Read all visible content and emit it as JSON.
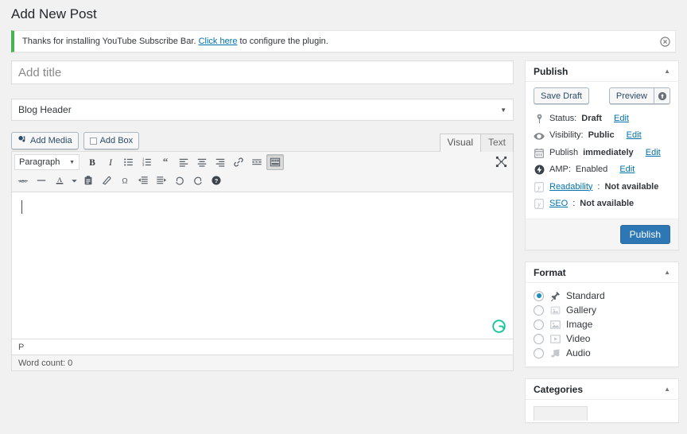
{
  "page": {
    "title": "Add New Post"
  },
  "notice": {
    "text_before": "Thanks for installing YouTube Subscribe Bar. ",
    "link": "Click here",
    "text_after": " to configure the plugin.",
    "dismiss_icon": "dismiss-circle-icon",
    "accent_color": "#46b450"
  },
  "title_field": {
    "value": "",
    "placeholder": "Add title"
  },
  "template": {
    "selected": "Blog Header",
    "caret": "▼"
  },
  "editor": {
    "add_media_label": "Add Media",
    "add_box_label": "Add Box",
    "tabs": [
      {
        "label": "Visual",
        "active": true
      },
      {
        "label": "Text",
        "active": false
      }
    ],
    "style_select": {
      "value": "Paragraph",
      "caret": "▼"
    },
    "toolbar_row1": [
      {
        "name": "bold-icon",
        "glyph": "B"
      },
      {
        "name": "italic-icon",
        "glyph": "I"
      },
      {
        "name": "bulleted-list-icon",
        "glyph": ""
      },
      {
        "name": "numbered-list-icon",
        "glyph": ""
      },
      {
        "name": "blockquote-icon",
        "glyph": "“"
      },
      {
        "name": "align-left-icon",
        "glyph": ""
      },
      {
        "name": "align-center-icon",
        "glyph": ""
      },
      {
        "name": "align-right-icon",
        "glyph": ""
      },
      {
        "name": "insert-link-icon",
        "glyph": ""
      },
      {
        "name": "read-more-icon",
        "glyph": ""
      },
      {
        "name": "toolbar-toggle-icon",
        "glyph": "",
        "pressed": true
      }
    ],
    "toolbar_row2": [
      {
        "name": "strikethrough-icon",
        "glyph": "ABC"
      },
      {
        "name": "horizontal-rule-icon",
        "glyph": "—"
      },
      {
        "name": "text-color-icon",
        "glyph": "A"
      },
      {
        "name": "text-color-caret-icon",
        "glyph": "▼"
      },
      {
        "name": "paste-as-text-icon",
        "glyph": ""
      },
      {
        "name": "clear-formatting-icon",
        "glyph": ""
      },
      {
        "name": "special-character-icon",
        "glyph": "Ω"
      },
      {
        "name": "outdent-icon",
        "glyph": ""
      },
      {
        "name": "indent-icon",
        "glyph": ""
      },
      {
        "name": "undo-icon",
        "glyph": ""
      },
      {
        "name": "redo-icon",
        "glyph": ""
      },
      {
        "name": "keyboard-shortcuts-icon",
        "glyph": "?"
      }
    ],
    "fullscreen_icon": "distraction-free-mode-icon",
    "content": "",
    "grammarly_icon": "grammarly-badge-icon",
    "path": "P",
    "word_count": "Word count: 0"
  },
  "publish_box": {
    "title": "Publish",
    "toggle": "▲",
    "save_draft_label": "Save Draft",
    "preview_label": "Preview",
    "preview_extra_icon": "preview-options-icon",
    "rows": [
      {
        "icon": "pin-icon",
        "label": "Status: ",
        "value": "Draft",
        "edit": "Edit",
        "value_bold": true
      },
      {
        "icon": "eye-icon",
        "label": "Visibility: ",
        "value": "Public",
        "edit": "Edit",
        "value_bold": true
      },
      {
        "icon": "calendar-icon",
        "label": "Publish ",
        "value": "immediately",
        "edit": "Edit",
        "value_bold": true
      },
      {
        "icon": "amp-icon",
        "label": "AMP: ",
        "value": "Enabled",
        "edit": "Edit",
        "value_bold": false
      },
      {
        "icon": "yoast-icon",
        "label_link": "Readability",
        "label": ": ",
        "value": "Not available",
        "value_bold": false
      },
      {
        "icon": "yoast-icon",
        "label_link": "SEO",
        "label": ": ",
        "value": "Not available",
        "value_bold": false
      }
    ],
    "publish_label": "Publish",
    "publish_color": "#2e77b5"
  },
  "format_box": {
    "title": "Format",
    "toggle": "▲",
    "options": [
      {
        "label": "Standard",
        "icon": "pin-format-icon",
        "selected": true
      },
      {
        "label": "Gallery",
        "icon": "gallery-format-icon",
        "selected": false
      },
      {
        "label": "Image",
        "icon": "image-format-icon",
        "selected": false
      },
      {
        "label": "Video",
        "icon": "video-format-icon",
        "selected": false
      },
      {
        "label": "Audio",
        "icon": "audio-format-icon",
        "selected": false
      }
    ]
  },
  "categories_box": {
    "title": "Categories",
    "toggle": "▲"
  }
}
